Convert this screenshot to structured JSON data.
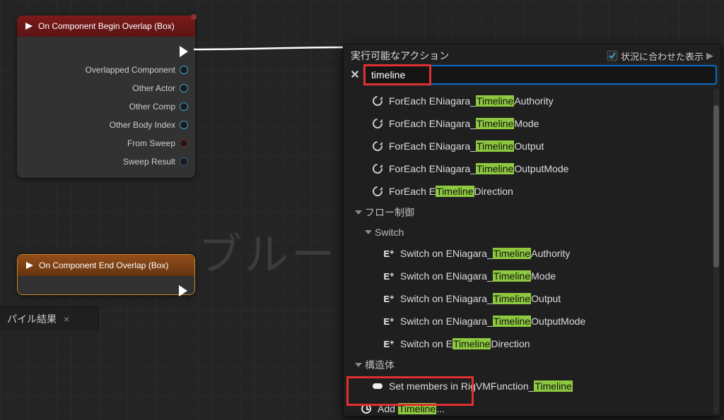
{
  "colors": {
    "highlight": "#8ec93f",
    "accent_red": "#e03030",
    "focus_blue": "#0074d9"
  },
  "graph_watermark": "ブルー",
  "nodes": {
    "begin": {
      "title": "On Component Begin Overlap (Box)",
      "pins": [
        "Overlapped Component",
        "Other Actor",
        "Other Comp",
        "Other Body Index",
        "From Sweep",
        "Sweep Result"
      ]
    },
    "end": {
      "title": "On Component End Overlap (Box)"
    }
  },
  "results_panel": {
    "label": "パイル結果",
    "close": "×"
  },
  "menu": {
    "title": "実行可能なアクション",
    "context_label": "状況に合わせた表示",
    "context_checked": true,
    "chevron": "▶",
    "close": "✕",
    "search_value": "timeline",
    "foreach_prefix": "ForEach ENiagara_",
    "foreach_last_prefix": "ForEach E",
    "foreach_suffixes": [
      "Authority",
      "Mode",
      "Output",
      "OutputMode"
    ],
    "foreach_last_suffix": "Direction",
    "cat_flow": "フロー制御",
    "cat_switch": "Switch",
    "cat_struct": "構造体",
    "switch_prefix": "Switch on ENiagara_",
    "switch_last_prefix": "Switch on E",
    "switch_suffixes": [
      "Authority",
      "Mode",
      "Output",
      "OutputMode"
    ],
    "switch_last_suffix": "Direction",
    "struct_item_pre": "Set members in RigVMFunction_",
    "struct_item_hl": "Timeline",
    "add_prefix": "Add ",
    "add_hl": "Timeline",
    "add_suffix": "...",
    "hl": "Timeline"
  }
}
